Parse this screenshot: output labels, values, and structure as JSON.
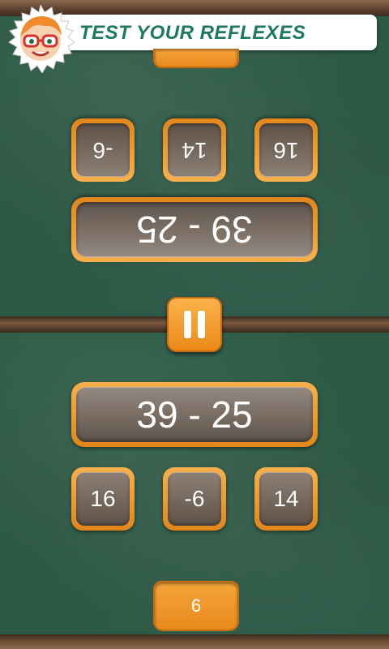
{
  "header": {
    "title": "TEST YOUR REFLEXES"
  },
  "player_top": {
    "score": "",
    "question": "39 - 25",
    "answers": [
      "16",
      "14",
      "-6"
    ]
  },
  "player_bottom": {
    "score": "6",
    "question": "39 - 25",
    "answers": [
      "16",
      "-6",
      "14"
    ]
  },
  "controls": {
    "pause_icon": "pause-icon"
  },
  "colors": {
    "board_green": "#2d5a47",
    "accent_orange": "#f0952a",
    "title_green": "#1d7a5a",
    "tile_gray": "#7c7067"
  }
}
